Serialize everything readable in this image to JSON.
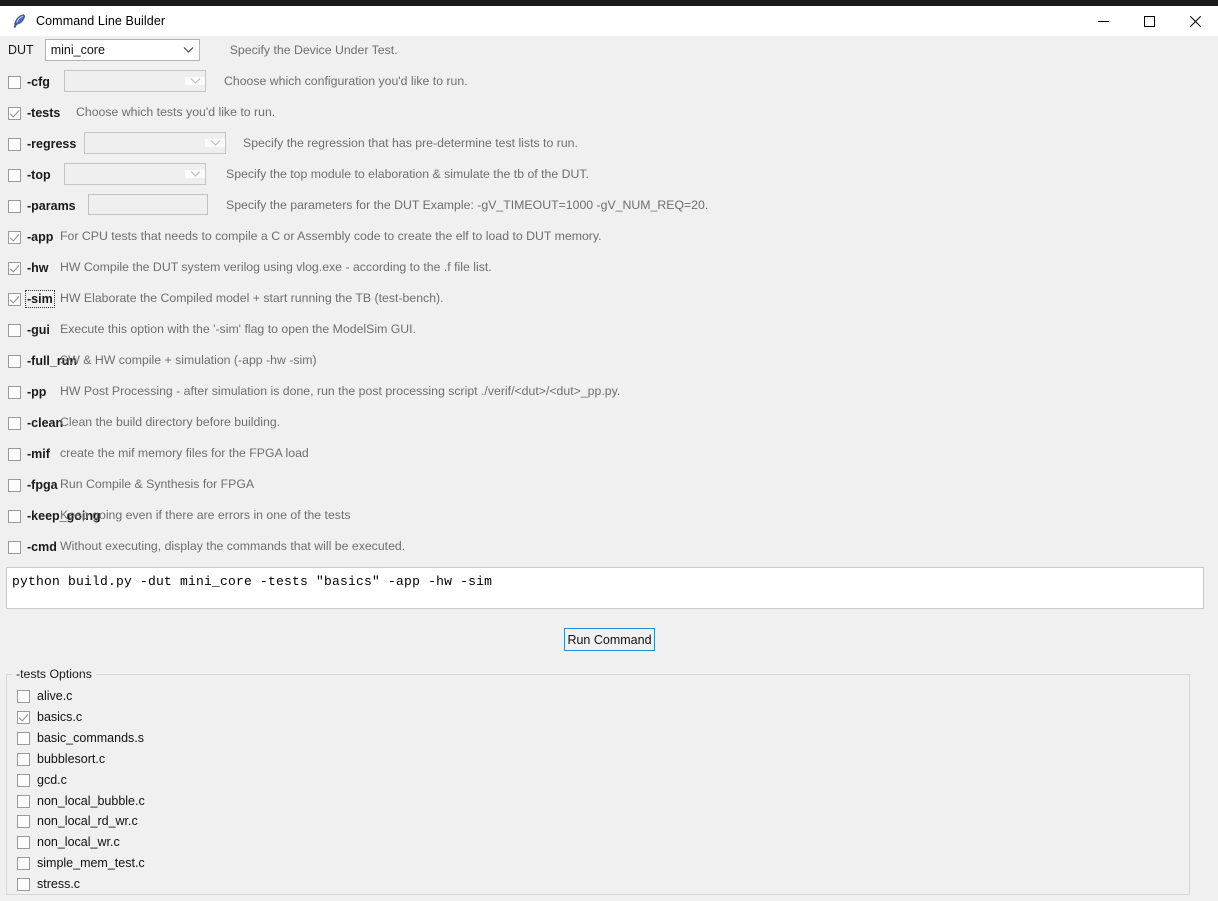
{
  "window": {
    "title": "Command Line Builder",
    "icon": "feather-icon",
    "controls": {
      "minimize": "minimize-icon",
      "maximize": "maximize-icon",
      "close": "close-icon"
    }
  },
  "dut": {
    "label": "DUT",
    "value": "mini_core",
    "description": "Specify the Device Under Test."
  },
  "options": [
    {
      "flag": "-cfg",
      "checked": false,
      "focused": false,
      "widget": "combo",
      "widget_value": "",
      "widget_enabled": false,
      "description": "Choose which configuration you'd like to run."
    },
    {
      "flag": "-tests",
      "checked": true,
      "focused": false,
      "widget": "none",
      "widget_value": "",
      "widget_enabled": false,
      "description": "Choose which tests you'd like to run."
    },
    {
      "flag": "-regress",
      "checked": false,
      "focused": false,
      "widget": "combo",
      "widget_value": "",
      "widget_enabled": false,
      "description": "Specify the regression that has pre-determine test lists to run."
    },
    {
      "flag": "-top",
      "checked": false,
      "focused": false,
      "widget": "combo",
      "widget_value": "",
      "widget_enabled": false,
      "description": "Specify the top module to elaboration & simulate the tb of the DUT."
    },
    {
      "flag": "-params",
      "checked": false,
      "focused": false,
      "widget": "entry",
      "widget_value": "",
      "widget_enabled": false,
      "description": "Specify the parameters for the DUT  Example: -gV_TIMEOUT=1000 -gV_NUM_REQ=20."
    },
    {
      "flag": "-app",
      "checked": true,
      "focused": false,
      "widget": "none",
      "widget_value": "",
      "widget_enabled": false,
      "description": "For CPU tests that needs to compile a C or Assembly code to create the elf to load to DUT memory."
    },
    {
      "flag": "-hw",
      "checked": true,
      "focused": false,
      "widget": "none",
      "widget_value": "",
      "widget_enabled": false,
      "description": "HW Compile the DUT system verilog using vlog.exe - according to the .f file list."
    },
    {
      "flag": "-sim",
      "checked": true,
      "focused": true,
      "widget": "none",
      "widget_value": "",
      "widget_enabled": false,
      "description": "HW Elaborate the Compiled model + start running the TB (test-bench)."
    },
    {
      "flag": "-gui",
      "checked": false,
      "focused": false,
      "widget": "none",
      "widget_value": "",
      "widget_enabled": false,
      "description": "Execute this option with the '-sim' flag to open the ModelSim GUI."
    },
    {
      "flag": "-full_run",
      "checked": false,
      "focused": false,
      "widget": "none",
      "widget_value": "",
      "widget_enabled": false,
      "description": "SW & HW compile + simulation (-app -hw -sim)"
    },
    {
      "flag": "-pp",
      "checked": false,
      "focused": false,
      "widget": "none",
      "widget_value": "",
      "widget_enabled": false,
      "description": "HW Post Processing - after simulation is done, run the post processing script ./verif/<dut>/<dut>_pp.py."
    },
    {
      "flag": "-clean",
      "checked": false,
      "focused": false,
      "widget": "none",
      "widget_value": "",
      "widget_enabled": false,
      "description": "Clean the build directory before building."
    },
    {
      "flag": "-mif",
      "checked": false,
      "focused": false,
      "widget": "none",
      "widget_value": "",
      "widget_enabled": false,
      "description": "create the mif memory files for the FPGA load"
    },
    {
      "flag": "-fpga",
      "checked": false,
      "focused": false,
      "widget": "none",
      "widget_value": "",
      "widget_enabled": false,
      "description": "Run Compile & Synthesis for FPGA"
    },
    {
      "flag": "-keep_going",
      "checked": false,
      "focused": false,
      "widget": "none",
      "widget_value": "",
      "widget_enabled": false,
      "description": "Keep going even if there are errors in one of the tests"
    },
    {
      "flag": "-cmd",
      "checked": false,
      "focused": false,
      "widget": "none",
      "widget_value": "",
      "widget_enabled": false,
      "description": "Without executing, display the commands that will be executed."
    }
  ],
  "command": {
    "text": "python build.py -dut mini_core -tests \"basics\" -app -hw -sim"
  },
  "run_button": {
    "label": "Run Command",
    "border_color": "#2f8ad4"
  },
  "tests_group": {
    "title": "-tests Options",
    "items": [
      {
        "label": "alive.c",
        "checked": false
      },
      {
        "label": "basics.c",
        "checked": true
      },
      {
        "label": "basic_commands.s",
        "checked": false
      },
      {
        "label": "bubblesort.c",
        "checked": false
      },
      {
        "label": "gcd.c",
        "checked": false
      },
      {
        "label": "non_local_bubble.c",
        "checked": false
      },
      {
        "label": "non_local_rd_wr.c",
        "checked": false
      },
      {
        "label": "non_local_wr.c",
        "checked": false
      },
      {
        "label": "simple_mem_test.c",
        "checked": false
      },
      {
        "label": "stress.c",
        "checked": false
      }
    ]
  },
  "theme": {
    "background": "#f0f0f0",
    "titlebar_background": "#ffffff",
    "text": "#1a1a1a",
    "muted_text": "#6e6e6e",
    "accent": "#2f8ad4"
  }
}
